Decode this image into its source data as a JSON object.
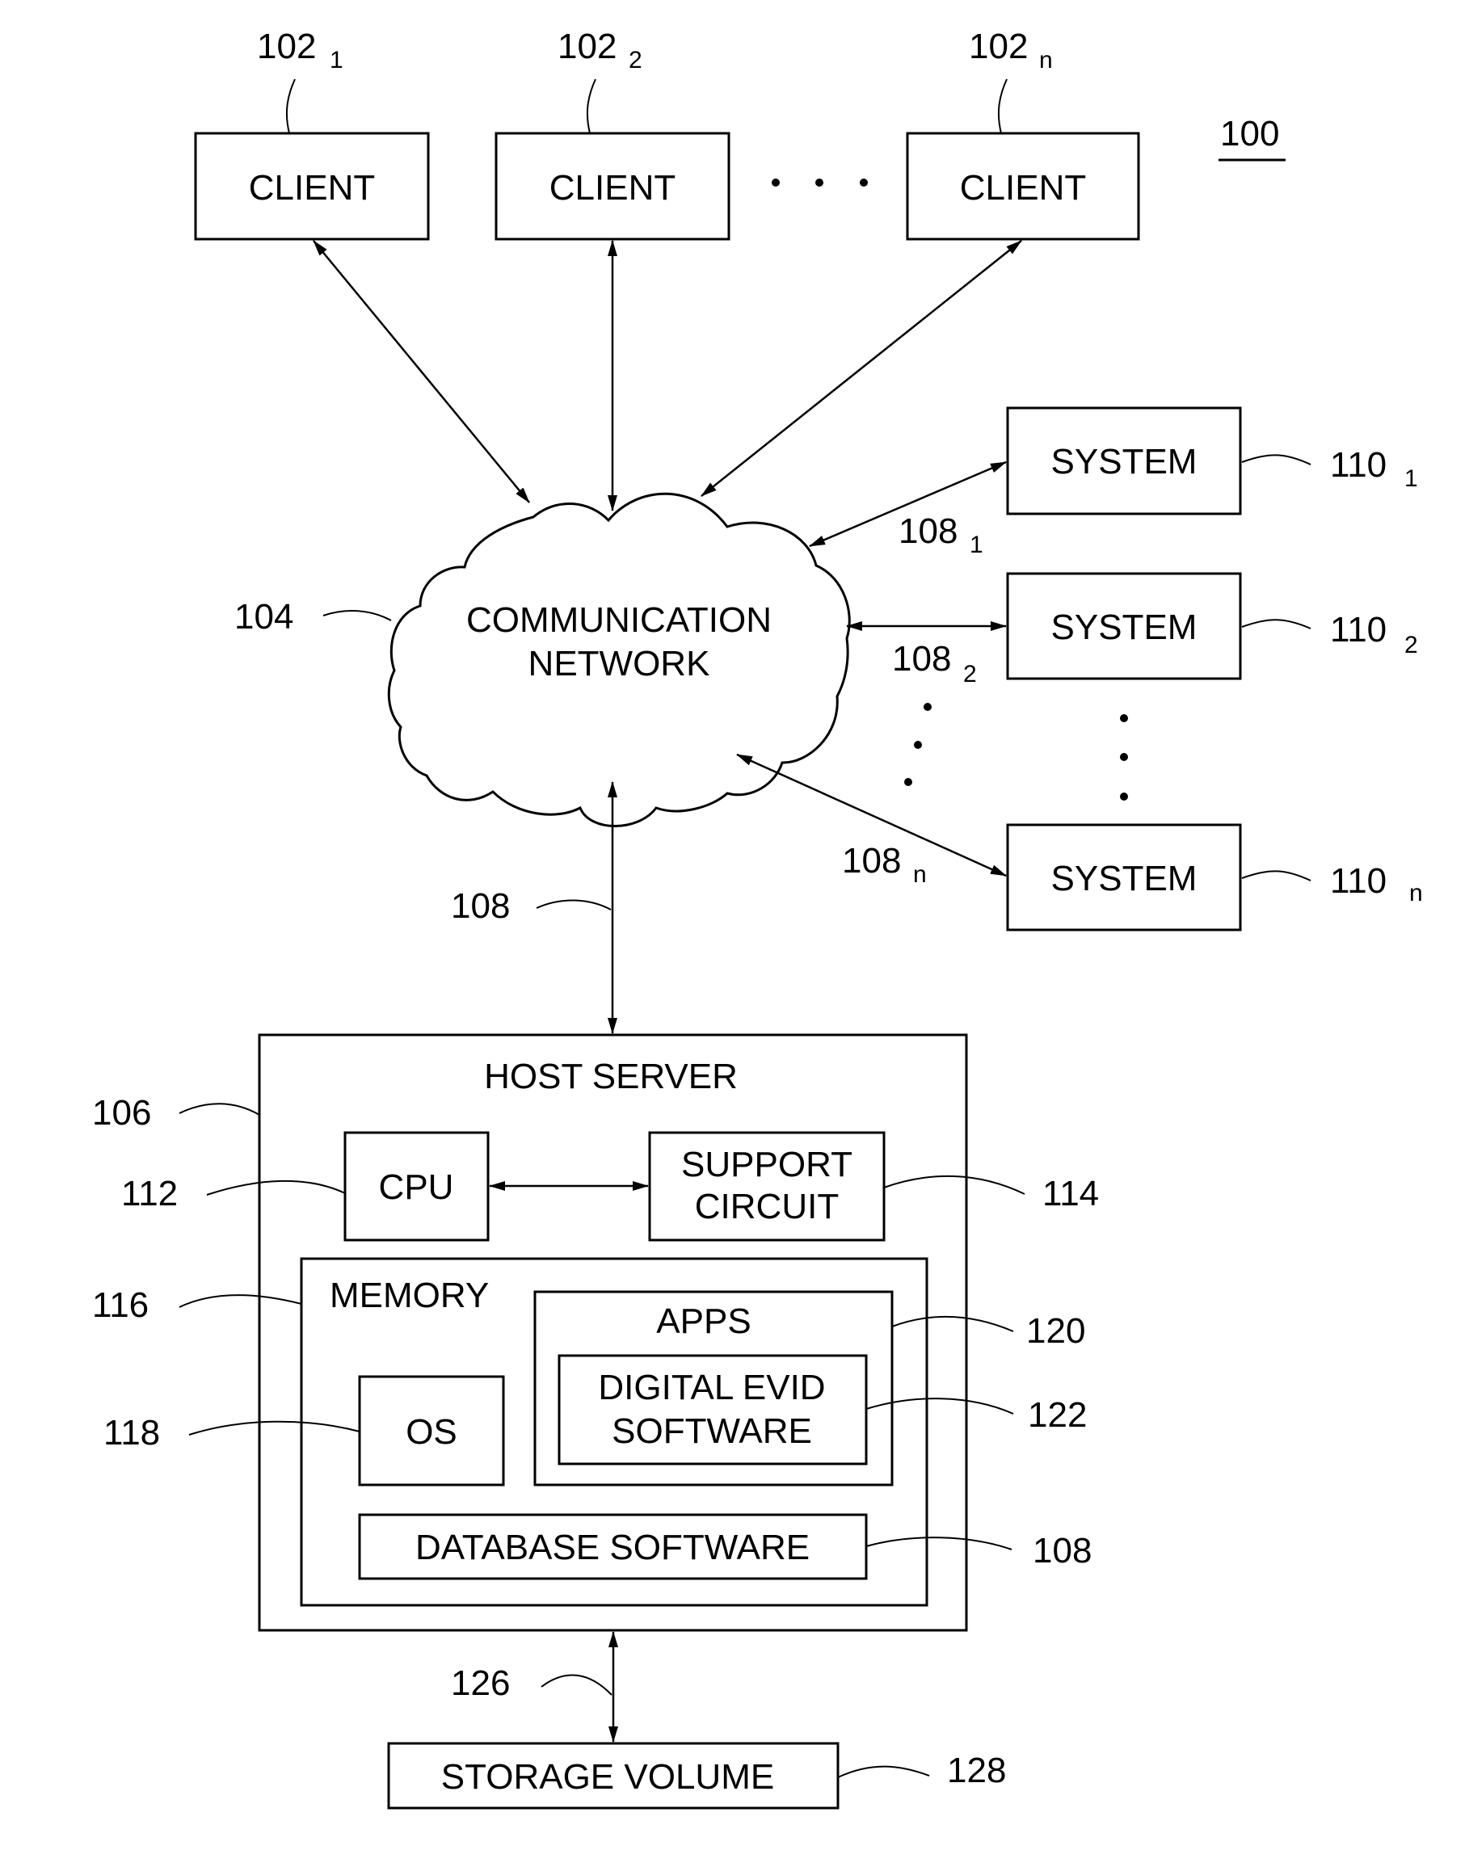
{
  "figure": {
    "reference": "100",
    "clients": [
      {
        "label": "CLIENT",
        "ref": "102",
        "sub": "1"
      },
      {
        "label": "CLIENT",
        "ref": "102",
        "sub": "2"
      },
      {
        "label": "CLIENT",
        "ref": "102",
        "sub": "n"
      }
    ],
    "network": {
      "label_line1": "COMMUNICATION",
      "label_line2": "NETWORK",
      "ref": "104"
    },
    "systems": [
      {
        "label": "SYSTEM",
        "ref": "110",
        "sub": "1",
        "link_ref": "108",
        "link_sub": "1"
      },
      {
        "label": "SYSTEM",
        "ref": "110",
        "sub": "2",
        "link_ref": "108",
        "link_sub": "2"
      },
      {
        "label": "SYSTEM",
        "ref": "110",
        "sub": "n",
        "link_ref": "108",
        "link_sub": "n"
      }
    ],
    "host_link_ref": "108",
    "host_server": {
      "label": "HOST SERVER",
      "ref": "106",
      "cpu": {
        "label": "CPU",
        "ref": "112"
      },
      "support": {
        "label_line1": "SUPPORT",
        "label_line2": "CIRCUIT",
        "ref": "114"
      },
      "memory": {
        "label": "MEMORY",
        "ref": "116"
      },
      "apps": {
        "label": "APPS",
        "ref": "120"
      },
      "digital_evid": {
        "label_line1": "DIGITAL EVID",
        "label_line2": "SOFTWARE",
        "ref": "122"
      },
      "os": {
        "label": "OS",
        "ref": "118"
      },
      "database": {
        "label": "DATABASE SOFTWARE",
        "ref": "108"
      }
    },
    "storage_link_ref": "126",
    "storage": {
      "label": "STORAGE VOLUME",
      "ref": "128"
    }
  }
}
